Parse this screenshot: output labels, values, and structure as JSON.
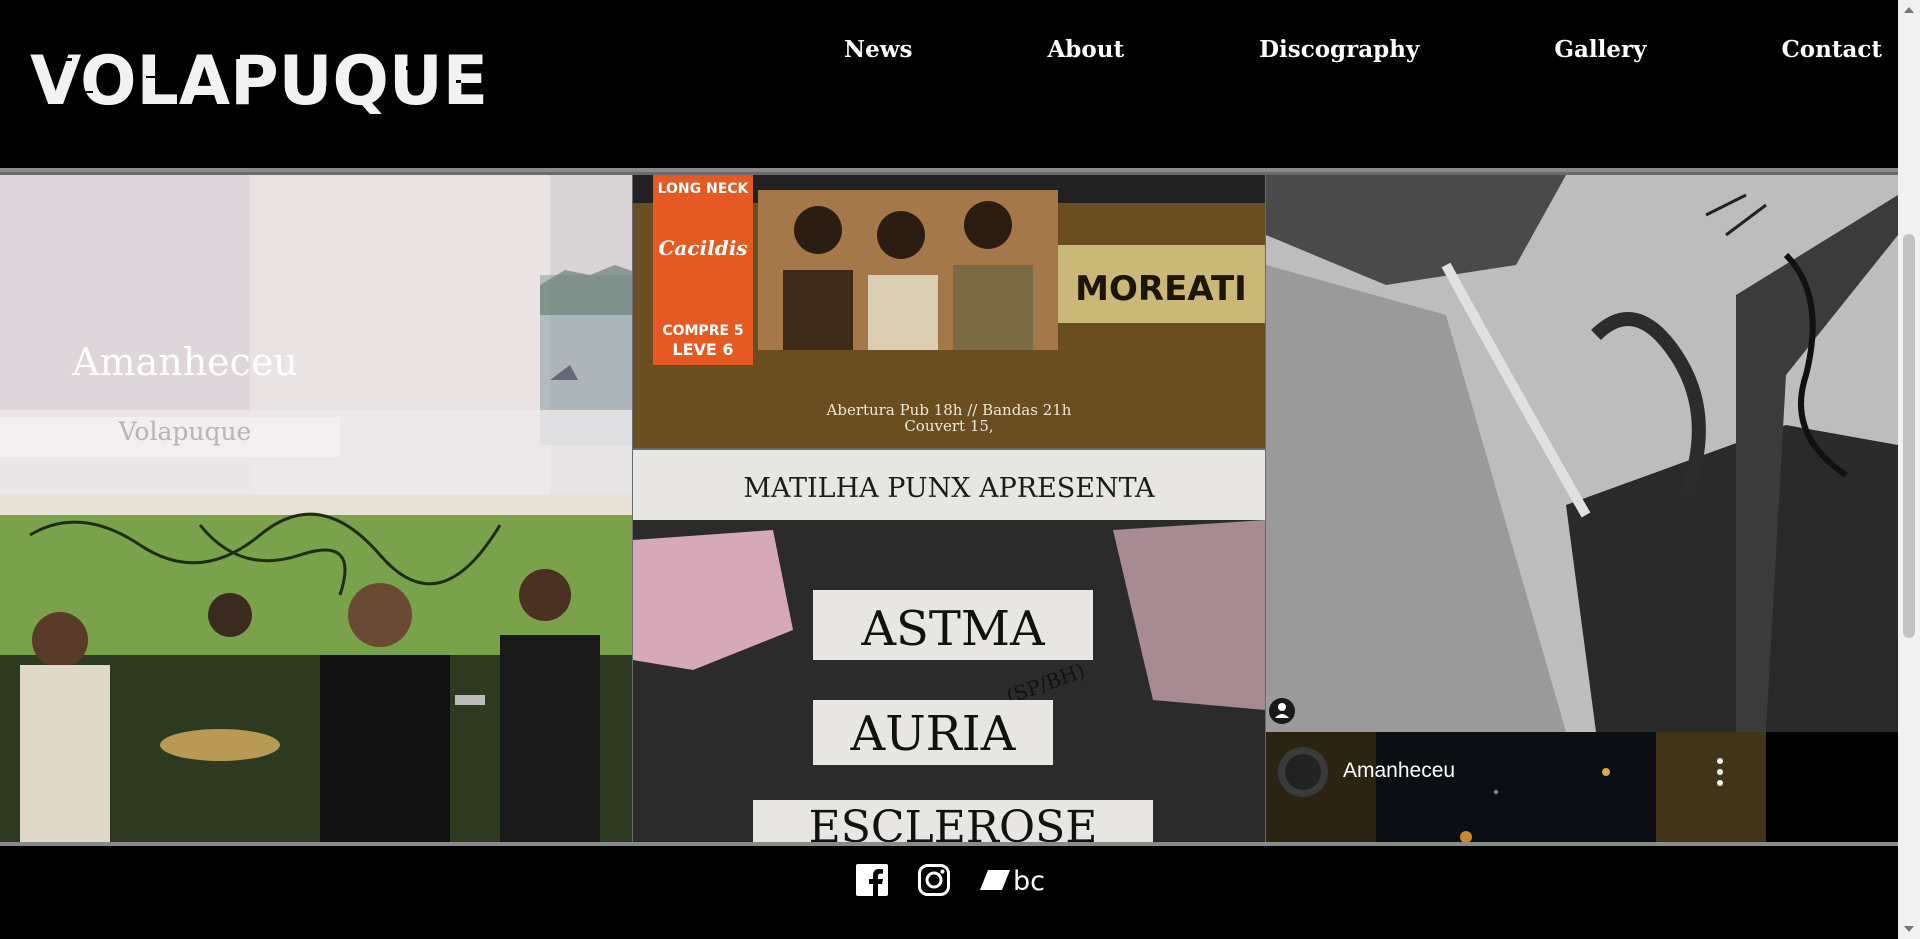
{
  "brand": {
    "name": "VOLAPUQUE"
  },
  "nav": {
    "items": [
      "News",
      "About",
      "Discography",
      "Gallery",
      "Contact"
    ]
  },
  "gallery": {
    "video_thumb": {
      "title": "Amanheceu",
      "subtitle": "Volapuque"
    },
    "poster1": {
      "side_labels": [
        "LONG NECK",
        "Cacildis",
        "COMPRE 5",
        "LEVE 6"
      ],
      "band": "MOREATI",
      "info_line1": "Abertura Pub 18h // Bandas 21h",
      "info_line2": "Couvert 15,"
    },
    "poster2": {
      "heading": "MATILHA PUNX APRESENTA",
      "bands": [
        "ASTMA",
        "AURIA",
        "ESCLEROSE"
      ],
      "tag": "(SP/BH)"
    },
    "player": {
      "title": "Amanheceu"
    }
  },
  "footer": {
    "icons": [
      "facebook-icon",
      "instagram-icon",
      "bandcamp-icon"
    ],
    "bandcamp_text": "bc"
  },
  "colors": {
    "background": "#000000",
    "text": "#ffffff",
    "divider": "#8a8a8a"
  }
}
